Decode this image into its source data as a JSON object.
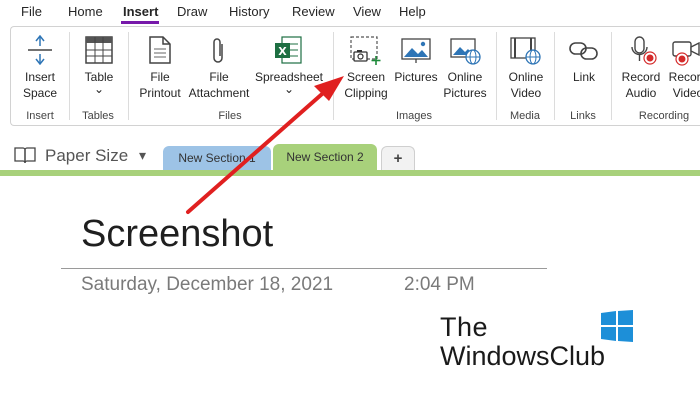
{
  "menu": {
    "items": [
      {
        "label": "File"
      },
      {
        "label": "Home"
      },
      {
        "label": "Insert"
      },
      {
        "label": "Draw"
      },
      {
        "label": "History"
      },
      {
        "label": "Review"
      },
      {
        "label": "View"
      },
      {
        "label": "Help"
      }
    ],
    "active": "Insert"
  },
  "ribbon": {
    "insert_space": {
      "line1": "Insert",
      "line2": "Space",
      "icon": "insert-space-icon"
    },
    "table": {
      "label": "Table",
      "dropdown": "⌄",
      "icon": "table-icon"
    },
    "file_printout": {
      "line1": "File",
      "line2": "Printout",
      "icon": "file-printout-icon"
    },
    "file_attachment": {
      "line1": "File",
      "line2": "Attachment",
      "icon": "paperclip-icon"
    },
    "spreadsheet": {
      "label": "Spreadsheet",
      "dropdown": "⌄",
      "icon": "excel-spreadsheet-icon"
    },
    "screen_clipping": {
      "line1": "Screen",
      "line2": "Clipping",
      "icon": "screen-clipping-icon"
    },
    "pictures": {
      "label": "Pictures",
      "icon": "pictures-icon"
    },
    "online_pictures": {
      "line1": "Online",
      "line2": "Pictures",
      "icon": "online-pictures-icon"
    },
    "online_video": {
      "line1": "Online",
      "line2": "Video",
      "icon": "online-video-icon"
    },
    "link": {
      "label": "Link",
      "icon": "link-icon"
    },
    "record_audio": {
      "line1": "Record",
      "line2": "Audio",
      "icon": "record-audio-icon"
    },
    "record_video": {
      "line1": "Record",
      "line2": "Video",
      "icon": "record-video-icon"
    },
    "groups": {
      "insert": "Insert",
      "tables": "Tables",
      "files": "Files",
      "images": "Images",
      "media": "Media",
      "links": "Links",
      "recording": "Recording"
    }
  },
  "notebook": {
    "page_size_label": "Paper Size",
    "page_size_caret": "▾",
    "sections": [
      {
        "label": "New Section 1",
        "color": "#9dc3e6"
      },
      {
        "label": "New Section 2",
        "color": "#a8d17b",
        "active": true
      }
    ],
    "add_section": "+"
  },
  "page": {
    "title": "Screenshot",
    "date": "Saturday, December 18, 2021",
    "time": "2:04 PM"
  },
  "watermark": {
    "line1": "The",
    "line2": "WindowsClub"
  },
  "colors": {
    "accent": "#7719aa",
    "arrow": "#e02020",
    "record_red": "#d42a2a",
    "excel_green": "#1d6f42"
  }
}
